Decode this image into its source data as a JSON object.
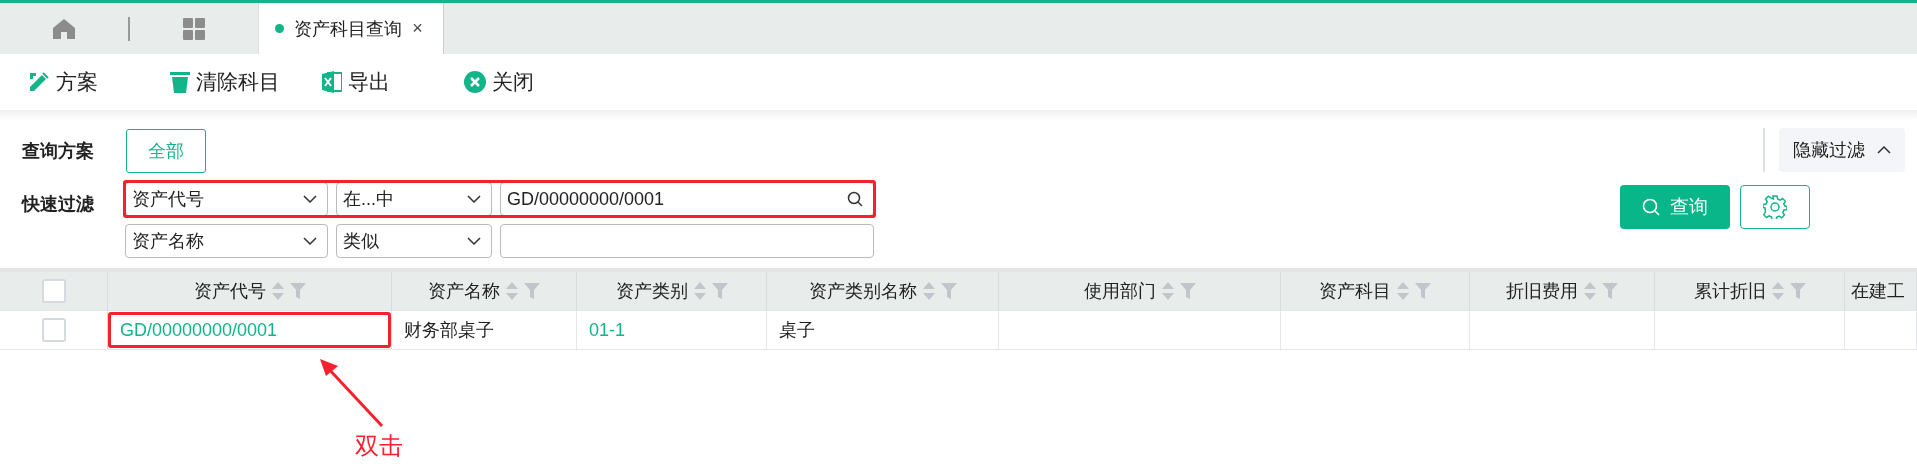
{
  "tabs": [
    {
      "kind": "home"
    },
    {
      "kind": "apps"
    },
    {
      "kind": "page",
      "label": "资产科目查询",
      "selected": true,
      "close": "×"
    }
  ],
  "toolbar": [
    {
      "kind": "scheme",
      "label": "方案"
    },
    {
      "kind": "trash",
      "label": "清除科目"
    },
    {
      "kind": "excel",
      "label": "导出"
    },
    {
      "kind": "close",
      "label": "关闭"
    }
  ],
  "filter": {
    "scheme_label": "查询方案",
    "scheme_button": "全部",
    "quick_label": "快速过滤",
    "hide_button": "隐藏过滤",
    "query_button": "查询",
    "rows": [
      {
        "field": "资产代号",
        "operator": "在...中",
        "value": "GD/00000000/0001",
        "highlighted": true
      },
      {
        "field": "资产名称",
        "operator": "类似",
        "value": "",
        "highlighted": false
      }
    ]
  },
  "table": {
    "header_checked": false,
    "columns": [
      "资产代号",
      "资产名称",
      "资产类别",
      "资产类别名称",
      "使用部门",
      "资产科目",
      "折旧费用",
      "累计折旧",
      "在建工"
    ],
    "rows": [
      {
        "checked": false,
        "cells": [
          {
            "text": "GD/00000000/0001",
            "kind": "link",
            "highlighted": true
          },
          {
            "text": "财务部桌子",
            "kind": "text",
            "highlighted": false
          },
          {
            "text": "01-1",
            "kind": "link",
            "highlighted": false
          },
          {
            "text": "桌子",
            "kind": "text",
            "highlighted": false
          },
          {
            "highlighted": false
          },
          {
            "highlighted": false
          },
          {
            "highlighted": false
          },
          {
            "highlighted": false
          },
          {
            "highlighted": false
          }
        ]
      }
    ]
  },
  "annotation": {
    "label": "双击"
  }
}
